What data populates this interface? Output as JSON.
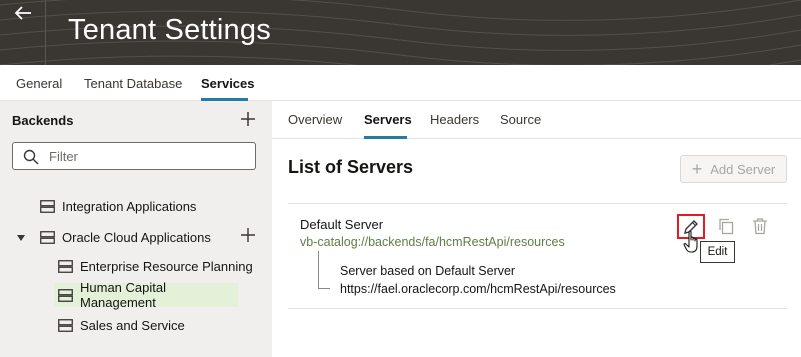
{
  "header": {
    "title": "Tenant Settings",
    "background_color": "#3a3632"
  },
  "top_tabs": [
    {
      "label": "General",
      "active": false
    },
    {
      "label": "Tenant Database",
      "active": false
    },
    {
      "label": "Services",
      "active": true
    }
  ],
  "sidebar": {
    "title": "Backends",
    "filter_placeholder": "Filter",
    "items": [
      {
        "label": "Integration Applications",
        "level": 0,
        "selected": false
      },
      {
        "label": "Oracle Cloud Applications",
        "level": 0,
        "expanded": true,
        "selected": false
      },
      {
        "label": "Enterprise Resource Planning",
        "level": 1,
        "selected": false
      },
      {
        "label": "Human Capital Management",
        "level": 1,
        "selected": true
      },
      {
        "label": "Sales and Service",
        "level": 1,
        "selected": false
      }
    ]
  },
  "sub_tabs": [
    {
      "label": "Overview",
      "active": false
    },
    {
      "label": "Servers",
      "active": true
    },
    {
      "label": "Headers",
      "active": false
    },
    {
      "label": "Source",
      "active": false
    }
  ],
  "main": {
    "section_title": "List of Servers",
    "add_server_label": "Add Server",
    "server": {
      "name": "Default Server",
      "url": "vb-catalog://backends/fa/hcmRestApi/resources",
      "based_on": "Server based on Default Server",
      "based_url": "https://fael.oraclecorp.com/hcmRestApi/resources"
    },
    "tooltip": "Edit"
  },
  "colors": {
    "accent": "#227e9e",
    "selected_bg": "#e2f1d8",
    "url_green": "#5e7f44",
    "highlight_red": "#e31b23"
  }
}
